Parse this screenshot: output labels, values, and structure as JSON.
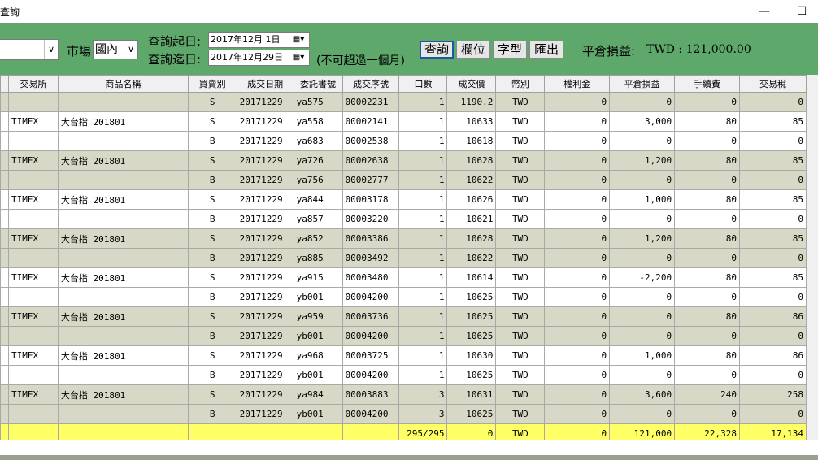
{
  "window": {
    "title": "查詢",
    "minimize": "—",
    "maximize": "☐"
  },
  "toolbar": {
    "account_value": "",
    "market_label": "市場",
    "market_value": "國內",
    "start_label": "查詢起日:",
    "start_date": "2017年12月 1日",
    "end_label": "查詢迄日:",
    "end_date": "2017年12月29日",
    "note": "(不可超過一個月)",
    "query_btn": "查詢",
    "columns_btn": "欄位",
    "font_btn": "字型",
    "export_btn": "匯出",
    "pnl_label": "平倉損益:",
    "pnl_value": "TWD : 121,000.00"
  },
  "columns": [
    "",
    "交易所",
    "商品名稱",
    "買賣別",
    "成交日期",
    "委託書號",
    "成交序號",
    "口數",
    "成交價",
    "幣別",
    "權利金",
    "平倉損益",
    "手續費",
    "交易稅"
  ],
  "rows": [
    {
      "shade": true,
      "cells": [
        "",
        "",
        "",
        "S",
        "20171229",
        "ya575",
        "00002231",
        "1",
        "1190.2",
        "TWD",
        "0",
        "0",
        "0",
        "0"
      ]
    },
    {
      "shade": false,
      "cells": [
        "",
        "TIMEX",
        "大台指 201801",
        "S",
        "20171229",
        "ya558",
        "00002141",
        "1",
        "10633",
        "TWD",
        "0",
        "3,000",
        "80",
        "85"
      ]
    },
    {
      "shade": false,
      "cells": [
        "",
        "",
        "",
        "B",
        "20171229",
        "ya683",
        "00002538",
        "1",
        "10618",
        "TWD",
        "0",
        "0",
        "0",
        "0"
      ]
    },
    {
      "shade": true,
      "cells": [
        "",
        "TIMEX",
        "大台指 201801",
        "S",
        "20171229",
        "ya726",
        "00002638",
        "1",
        "10628",
        "TWD",
        "0",
        "1,200",
        "80",
        "85"
      ]
    },
    {
      "shade": true,
      "cells": [
        "",
        "",
        "",
        "B",
        "20171229",
        "ya756",
        "00002777",
        "1",
        "10622",
        "TWD",
        "0",
        "0",
        "0",
        "0"
      ]
    },
    {
      "shade": false,
      "cells": [
        "",
        "TIMEX",
        "大台指 201801",
        "S",
        "20171229",
        "ya844",
        "00003178",
        "1",
        "10626",
        "TWD",
        "0",
        "1,000",
        "80",
        "85"
      ]
    },
    {
      "shade": false,
      "cells": [
        "",
        "",
        "",
        "B",
        "20171229",
        "ya857",
        "00003220",
        "1",
        "10621",
        "TWD",
        "0",
        "0",
        "0",
        "0"
      ]
    },
    {
      "shade": true,
      "cells": [
        "",
        "TIMEX",
        "大台指 201801",
        "S",
        "20171229",
        "ya852",
        "00003386",
        "1",
        "10628",
        "TWD",
        "0",
        "1,200",
        "80",
        "85"
      ]
    },
    {
      "shade": true,
      "cells": [
        "",
        "",
        "",
        "B",
        "20171229",
        "ya885",
        "00003492",
        "1",
        "10622",
        "TWD",
        "0",
        "0",
        "0",
        "0"
      ]
    },
    {
      "shade": false,
      "cells": [
        "",
        "TIMEX",
        "大台指 201801",
        "S",
        "20171229",
        "ya915",
        "00003480",
        "1",
        "10614",
        "TWD",
        "0",
        "-2,200",
        "80",
        "85"
      ]
    },
    {
      "shade": false,
      "cells": [
        "",
        "",
        "",
        "B",
        "20171229",
        "yb001",
        "00004200",
        "1",
        "10625",
        "TWD",
        "0",
        "0",
        "0",
        "0"
      ]
    },
    {
      "shade": true,
      "cells": [
        "",
        "TIMEX",
        "大台指 201801",
        "S",
        "20171229",
        "ya959",
        "00003736",
        "1",
        "10625",
        "TWD",
        "0",
        "0",
        "80",
        "86"
      ]
    },
    {
      "shade": true,
      "cells": [
        "",
        "",
        "",
        "B",
        "20171229",
        "yb001",
        "00004200",
        "1",
        "10625",
        "TWD",
        "0",
        "0",
        "0",
        "0"
      ]
    },
    {
      "shade": false,
      "cells": [
        "",
        "TIMEX",
        "大台指 201801",
        "S",
        "20171229",
        "ya968",
        "00003725",
        "1",
        "10630",
        "TWD",
        "0",
        "1,000",
        "80",
        "86"
      ]
    },
    {
      "shade": false,
      "cells": [
        "",
        "",
        "",
        "B",
        "20171229",
        "yb001",
        "00004200",
        "1",
        "10625",
        "TWD",
        "0",
        "0",
        "0",
        "0"
      ]
    },
    {
      "shade": true,
      "cells": [
        "",
        "TIMEX",
        "大台指 201801",
        "S",
        "20171229",
        "ya984",
        "00003883",
        "3",
        "10631",
        "TWD",
        "0",
        "3,600",
        "240",
        "258"
      ]
    },
    {
      "shade": true,
      "cells": [
        "",
        "",
        "",
        "B",
        "20171229",
        "yb001",
        "00004200",
        "3",
        "10625",
        "TWD",
        "0",
        "0",
        "0",
        "0"
      ]
    }
  ],
  "total": [
    "",
    "",
    "",
    "",
    "",
    "",
    "",
    "295/295",
    "0",
    "TWD",
    "0",
    "121,000",
    "22,328",
    "17,134"
  ],
  "colors": {
    "toolbar_bg": "#5ea86b",
    "row_shade": "#d8d8c6",
    "total_bg": "#ffff66"
  }
}
